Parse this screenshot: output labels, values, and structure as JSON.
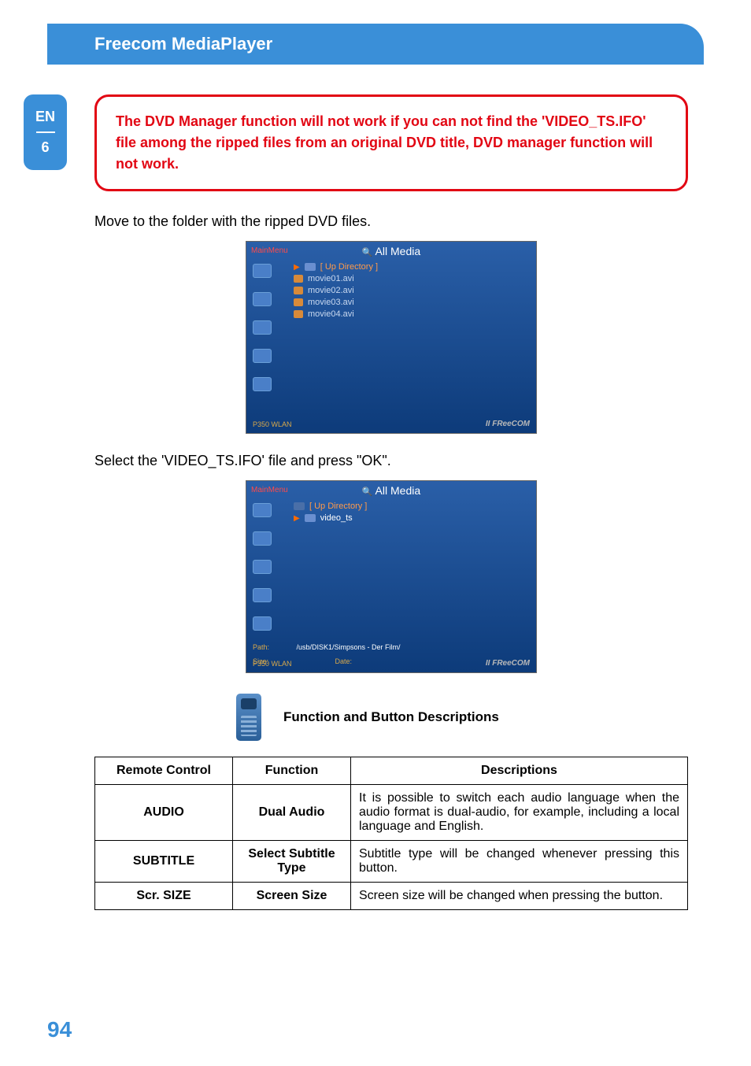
{
  "header": {
    "title": "Freecom MediaPlayer"
  },
  "sidetab": {
    "lang": "EN",
    "chapter": "6"
  },
  "warning": "The DVD Manager function will not work if you can not find the 'VIDEO_TS.IFO' file among the ripped files from an original DVD title, DVD manager function will not work.",
  "step1_text": "Move to the folder with the ripped DVD files.",
  "step2_text": "Select the 'VIDEO_TS.IFO' file and press \"OK\".",
  "screenshot1": {
    "mainmenu": "MainMenu",
    "title": "All Media",
    "updir": "[ Up Directory ]",
    "files": [
      "movie01.avi",
      "movie02.avi",
      "movie03.avi",
      "movie04.avi"
    ],
    "model": "P350 WLAN",
    "brand": "II FReeCOM"
  },
  "screenshot2": {
    "mainmenu": "MainMenu",
    "title": "All Media",
    "updir": "[ Up Directory ]",
    "selected": "video_ts",
    "path_label": "Path:",
    "path_val": "/usb/DISK1/Simpsons - Der Film/",
    "size_label": "Size:",
    "date_label": "Date:",
    "model": "P350 WLAN",
    "brand": "II FReeCOM"
  },
  "section_title": "Function and Button Descriptions",
  "table": {
    "headers": {
      "rc": "Remote Control",
      "fn": "Function",
      "desc": "Descriptions"
    },
    "rows": [
      {
        "rc": "AUDIO",
        "fn": "Dual Audio",
        "desc": "It is possible to switch each audio language when the audio format is dual-audio, for example, including a local language and English."
      },
      {
        "rc": "SUBTITLE",
        "fn": "Select Subtitle Type",
        "desc": "Subtitle type will be changed whenever pressing this button."
      },
      {
        "rc": "Scr. SIZE",
        "fn": "Screen Size",
        "desc": "Screen size will be changed when pressing the button."
      }
    ]
  },
  "page_number": "94"
}
